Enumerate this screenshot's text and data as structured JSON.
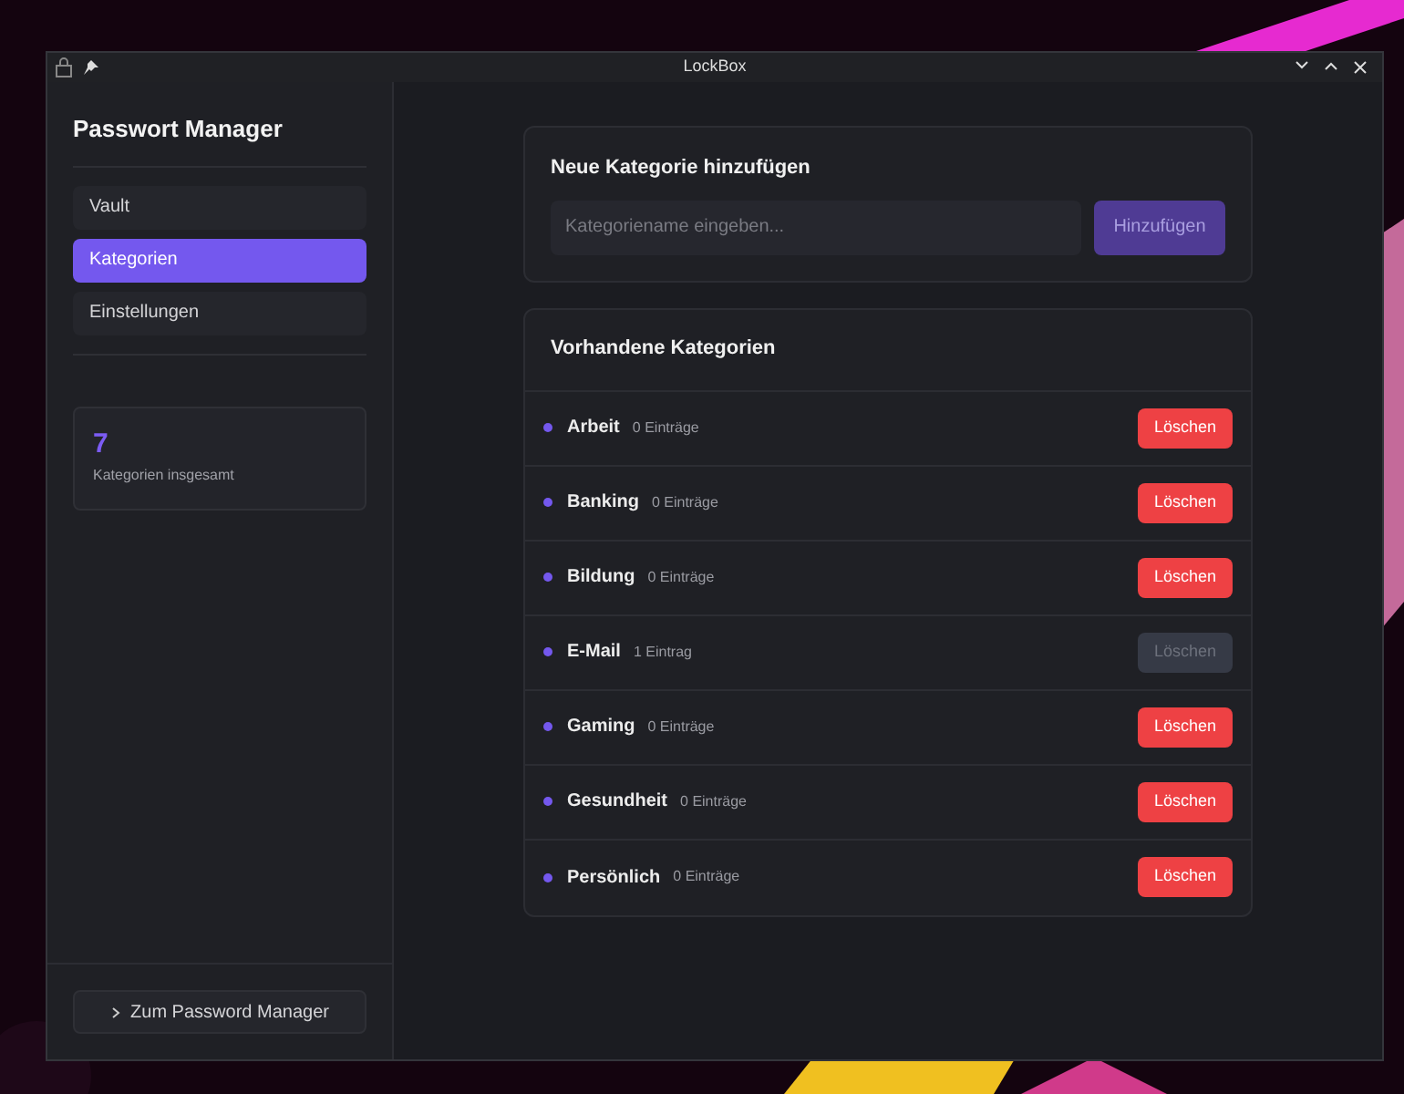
{
  "window": {
    "title": "LockBox"
  },
  "sidebar": {
    "title": "Passwort Manager",
    "items": [
      {
        "label": "Vault",
        "selected": false
      },
      {
        "label": "Kategorien",
        "selected": true
      },
      {
        "label": "Einstellungen",
        "selected": false
      }
    ],
    "stat": {
      "value": "7",
      "label": "Kategorien insgesamt"
    },
    "footer_button": "Zum Password Manager"
  },
  "add_card": {
    "title": "Neue Kategorie hinzufügen",
    "placeholder": "Kategoriename eingeben...",
    "button": "Hinzufügen"
  },
  "list_card": {
    "title": "Vorhandene Kategorien",
    "rows": [
      {
        "name": "Arbeit",
        "count": "0 Einträge",
        "button": "Löschen",
        "disabled": false
      },
      {
        "name": "Banking",
        "count": "0 Einträge",
        "button": "Löschen",
        "disabled": false
      },
      {
        "name": "Bildung",
        "count": "0 Einträge",
        "button": "Löschen",
        "disabled": false
      },
      {
        "name": "E-Mail",
        "count": "1 Eintrag",
        "button": "Löschen",
        "disabled": true
      },
      {
        "name": "Gaming",
        "count": "0 Einträge",
        "button": "Löschen",
        "disabled": false
      },
      {
        "name": "Gesundheit",
        "count": "0 Einträge",
        "button": "Löschen",
        "disabled": false
      },
      {
        "name": "Persönlich",
        "count": "0 Einträge",
        "button": "Löschen",
        "disabled": false
      }
    ]
  }
}
